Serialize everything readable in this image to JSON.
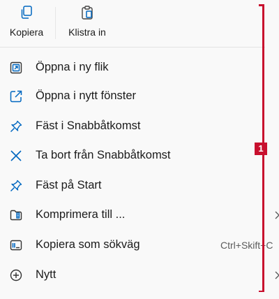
{
  "toolbar": {
    "copy": {
      "label": "Kopiera",
      "icon": "copy-icon"
    },
    "paste": {
      "label": "Klistra in",
      "icon": "paste-icon"
    }
  },
  "items": [
    {
      "label": "Öppna i ny flik",
      "icon": "open-new-tab-icon"
    },
    {
      "label": "Öppna i nytt fönster",
      "icon": "open-new-window-icon"
    },
    {
      "label": "Fäst i Snabbåtkomst",
      "icon": "pin-icon"
    },
    {
      "label": "Ta bort från Snabbåtkomst",
      "icon": "close-icon"
    },
    {
      "label": "Fäst på Start",
      "icon": "pin-icon"
    },
    {
      "label": "Komprimera till ...",
      "icon": "compress-folder-icon"
    },
    {
      "label": "Kopiera som sökväg",
      "icon": "copy-path-icon",
      "shortcut": "Ctrl+Skift+C"
    },
    {
      "label": "Nytt",
      "icon": "add-circle-icon"
    }
  ],
  "annotation": {
    "marker": "1",
    "color": "#c8102e"
  },
  "colors": {
    "icon_blue": "#0067c0",
    "background": "#f9f9f9"
  }
}
